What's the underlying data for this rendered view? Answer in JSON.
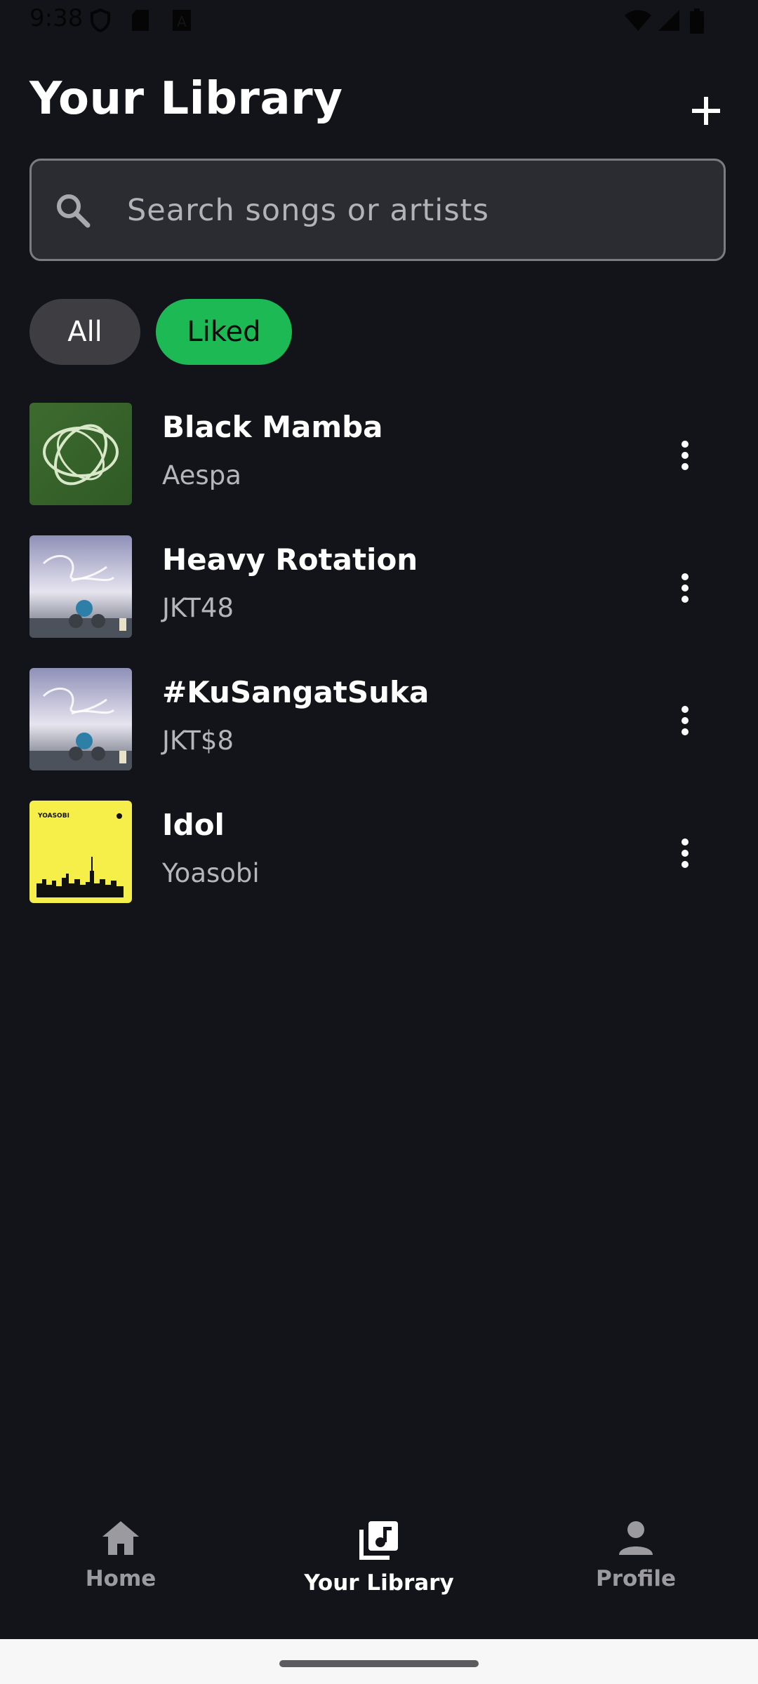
{
  "status_bar": {
    "time": "9:38",
    "icons": [
      "shield-icon",
      "sd-card-icon",
      "a-badge-icon",
      "wifi-icon",
      "signal-icon",
      "battery-icon"
    ]
  },
  "header": {
    "title": "Your Library",
    "add_icon": "plus-icon"
  },
  "search": {
    "placeholder": "Search songs or artists",
    "value": "",
    "icon": "search-icon"
  },
  "filters": [
    {
      "label": "All",
      "selected": false
    },
    {
      "label": "Liked",
      "selected": true
    }
  ],
  "songs": [
    {
      "title": "Black Mamba",
      "artist": "Aespa",
      "art": "green-field-artwork"
    },
    {
      "title": "Heavy Rotation",
      "artist": "JKT48",
      "art": "sky-cover-artwork"
    },
    {
      "title": "#KuSangatSuka",
      "artist": "JKT$8",
      "art": "sky-cover-artwork"
    },
    {
      "title": "Idol",
      "artist": "Yoasobi",
      "art": "yellow-city-artwork",
      "art_text": "YOASOBI"
    }
  ],
  "bottom_nav": {
    "items": [
      {
        "label": "Home",
        "icon": "home-icon",
        "active": false
      },
      {
        "label": "Your Library",
        "icon": "library-music-icon",
        "active": true
      },
      {
        "label": "Profile",
        "icon": "person-icon",
        "active": false
      }
    ]
  },
  "colors": {
    "background": "#13141a",
    "accent": "#1db954",
    "chip_inactive": "#3e3e42",
    "secondary_text": "#b6b6ba",
    "nav_inactive": "#9a9a9f"
  }
}
